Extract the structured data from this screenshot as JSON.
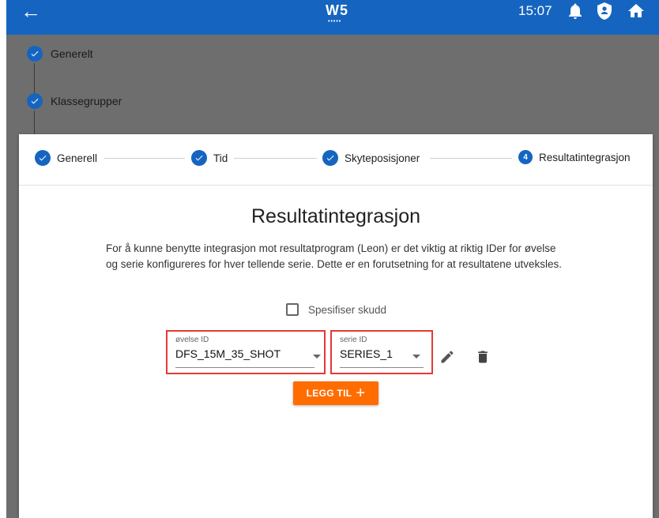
{
  "topbar": {
    "back_icon": "arrow-left-icon",
    "logo": "W5",
    "logo_dots": "•••••",
    "time": "15:07",
    "icons": [
      "bell-icon",
      "account-shield-icon",
      "home-icon"
    ]
  },
  "background_steps": [
    "Generelt",
    "Klassegrupper"
  ],
  "stepper": {
    "steps": [
      {
        "label": "Generell",
        "state": "done"
      },
      {
        "label": "Tid",
        "state": "done"
      },
      {
        "label": "Skyteposisjoner",
        "state": "done"
      },
      {
        "label": "Resultatintegrasjon",
        "state": "active",
        "number": "4"
      }
    ]
  },
  "main": {
    "title": "Resultatintegrasjon",
    "description": "For å kunne benytte integrasjon mot resultatprogram (Leon) er det viktig at riktig IDer for øvelse og serie konfigureres for hver tellende serie. Dette er en forutsetning for at resultatene utveksles.",
    "checkbox_label": "Spesifiser skudd",
    "checkbox_checked": false,
    "ovelse_field": {
      "label": "øvelse ID",
      "value": "DFS_15M_35_SHOT"
    },
    "serie_field": {
      "label": "serie ID",
      "value": "SERIES_1"
    },
    "add_button": "LEGG TIL"
  },
  "colors": {
    "primary": "#1565c0",
    "accent": "#ff6d00",
    "highlight": "#e53935"
  }
}
